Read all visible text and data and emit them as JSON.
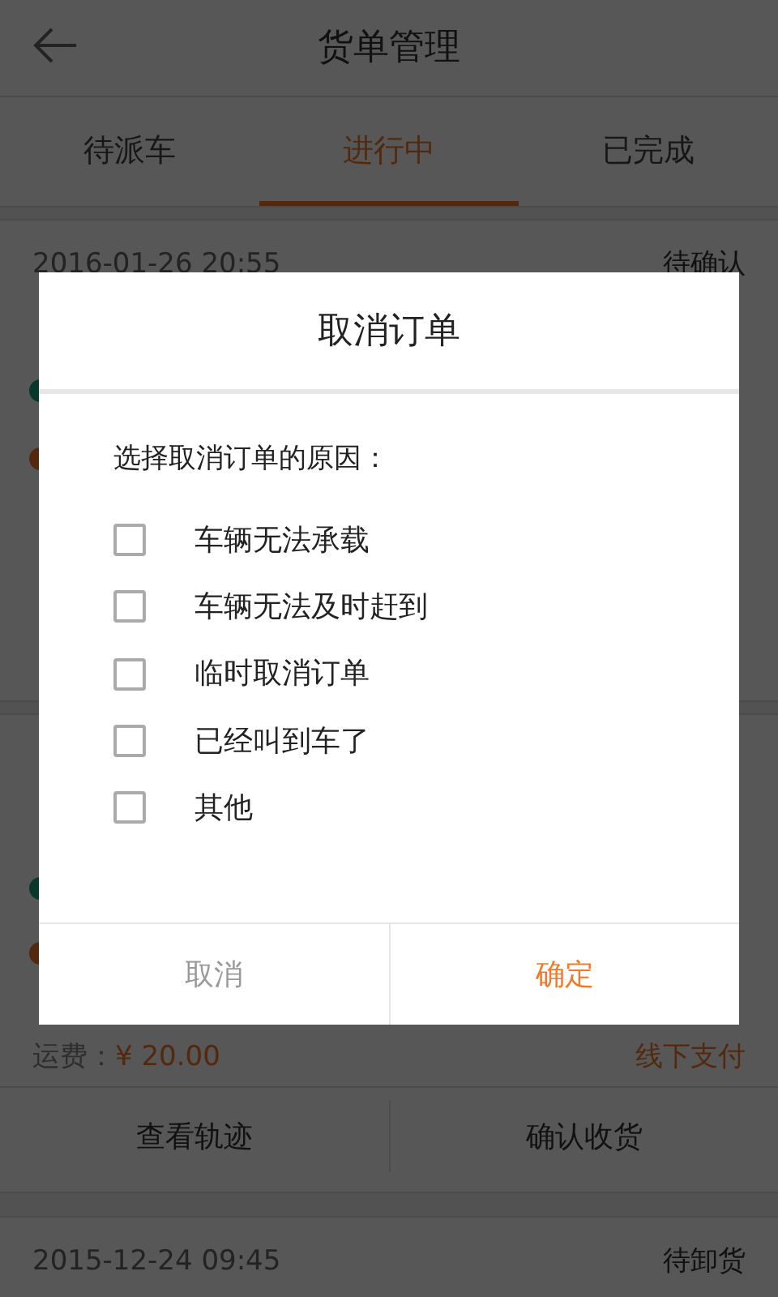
{
  "header": {
    "title": "货单管理"
  },
  "tabs": [
    {
      "label": "待派车",
      "selected": false
    },
    {
      "label": "进行中",
      "selected": true
    },
    {
      "label": "已完成",
      "selected": false
    }
  ],
  "orders": [
    {
      "time": "2016-01-26 20:55",
      "status": "待确认"
    },
    {
      "fee_label": "运费：",
      "fee": "¥ 20.00",
      "payment": "线下支付",
      "actions": [
        "查看轨迹",
        "确认收货"
      ]
    },
    {
      "time": "2015-12-24 09:45",
      "status": "待卸货"
    }
  ],
  "dialog": {
    "title": "取消订单",
    "prompt": "选择取消订单的原因：",
    "options": [
      {
        "label": "车辆无法承载",
        "checked": false
      },
      {
        "label": "车辆无法及时赶到",
        "checked": false
      },
      {
        "label": "临时取消订单",
        "checked": false
      },
      {
        "label": "已经叫到车了",
        "checked": false
      },
      {
        "label": "其他",
        "checked": false
      }
    ],
    "buttons": [
      {
        "label": "取消",
        "kind": "cancel"
      },
      {
        "label": "确定",
        "kind": "confirm"
      }
    ]
  }
}
